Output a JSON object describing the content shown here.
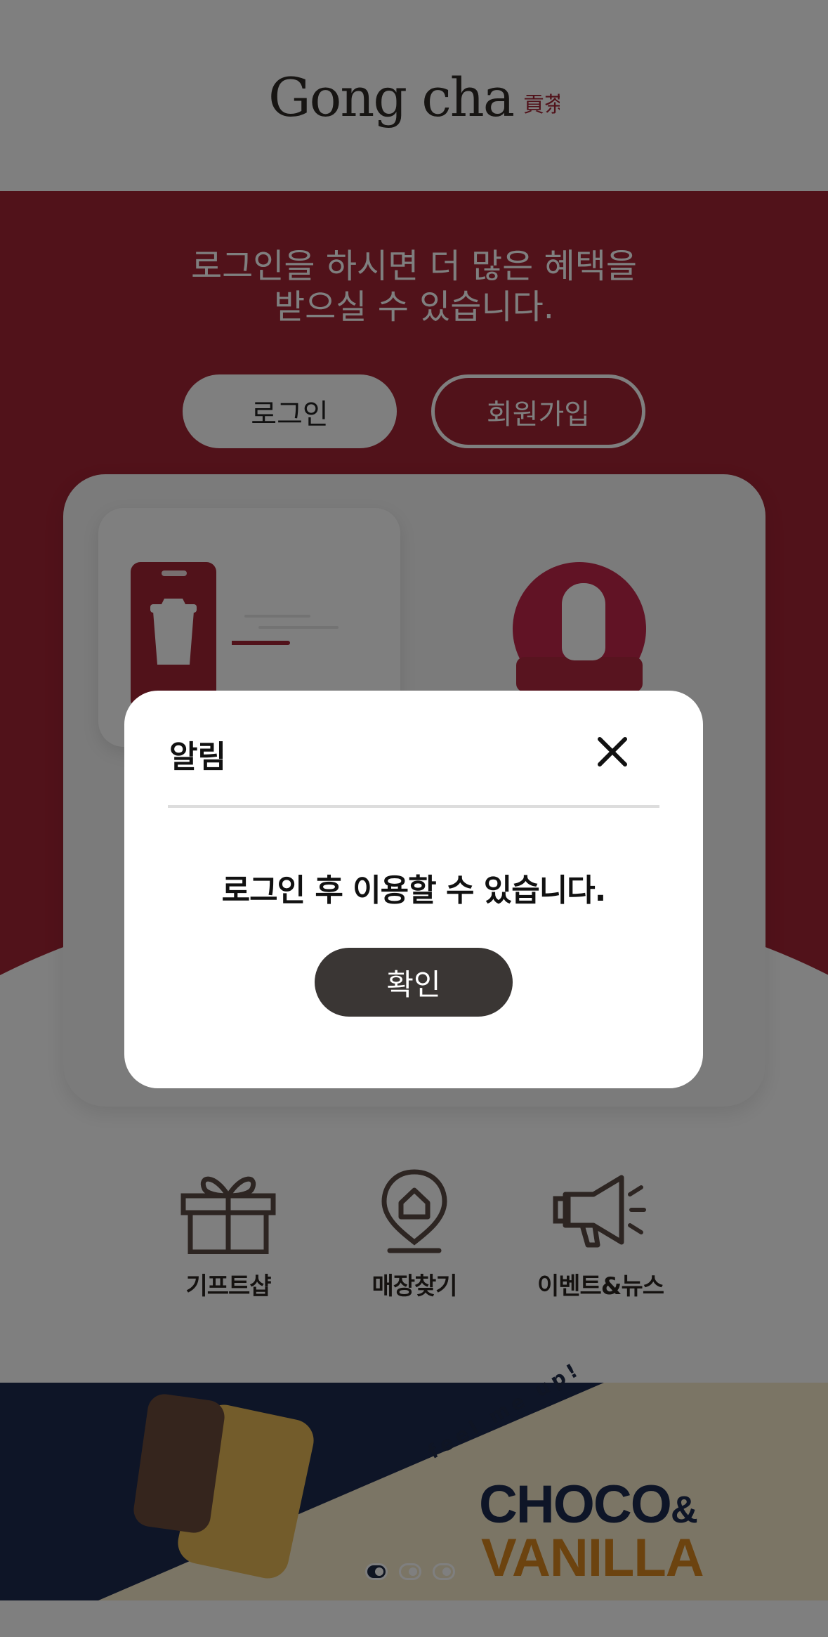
{
  "header": {
    "logo_text": "Gong cha",
    "logo_seal": "貢茶"
  },
  "hero": {
    "message_line1": "로그인을 하시면 더 많은 혜택을",
    "message_line2": "받으실 수 있습니다.",
    "login_label": "로그인",
    "join_label": "회원가입"
  },
  "feature_icons": [
    "phone-order-icon",
    "stamp-icon"
  ],
  "quick_menu": [
    {
      "label": "기프트샵",
      "icon": "gift-icon"
    },
    {
      "label": "매장찾기",
      "icon": "store-pin-icon"
    },
    {
      "label": "이벤트&뉴스",
      "icon": "megaphone-icon"
    }
  ],
  "banner": {
    "tagline": "feel me up!",
    "title_line1": "CHOCO",
    "title_amp": "&",
    "title_line2": "VANILLA",
    "slide_count": 3,
    "active_slide": 1
  },
  "modal": {
    "title": "알림",
    "message": "로그인 후 이용할 수 있습니다.",
    "confirm_label": "확인",
    "close_icon": "close-icon"
  },
  "colors": {
    "brand_red": "#a32434",
    "dark_button": "#3a3634",
    "navy": "#1d2a4e",
    "vanilla": "#d8861e"
  }
}
